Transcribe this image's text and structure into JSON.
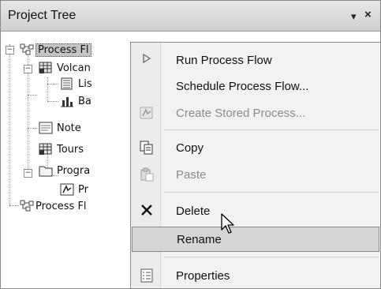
{
  "panel": {
    "title": "Project Tree",
    "pin_glyph": "▾",
    "close_glyph": "×"
  },
  "tree": {
    "nodes": [
      {
        "label": "Process Fl",
        "icon": "process-flow-icon",
        "expander": "−",
        "selected": true
      },
      {
        "label": "Volcan",
        "icon": "data-table-icon",
        "expander": "−"
      },
      {
        "label": "Lis",
        "icon": "list-report-icon"
      },
      {
        "label": "Ba",
        "icon": "bar-chart-icon"
      },
      {
        "label": "Note",
        "icon": "note-icon"
      },
      {
        "label": "Tours",
        "icon": "data-table-icon"
      },
      {
        "label": "Progra",
        "icon": "folder-icon",
        "expander": "−"
      },
      {
        "label": "Pr",
        "icon": "program-icon"
      },
      {
        "label": "Process Fl",
        "icon": "process-flow-icon"
      }
    ]
  },
  "context_menu": {
    "items": [
      {
        "label": "Run Process Flow",
        "icon": "run-triangle-icon",
        "enabled": true
      },
      {
        "label": "Schedule Process Flow...",
        "icon": "",
        "enabled": true
      },
      {
        "label": "Create Stored Process...",
        "icon": "stored-process-icon",
        "enabled": false
      },
      {
        "label": "Copy",
        "icon": "copy-icon",
        "enabled": true
      },
      {
        "label": "Paste",
        "icon": "paste-icon",
        "enabled": false
      },
      {
        "label": "Delete",
        "icon": "delete-x-icon",
        "enabled": true
      },
      {
        "label": "Rename",
        "icon": "",
        "enabled": true,
        "highlighted": true
      },
      {
        "label": "Properties",
        "icon": "properties-icon",
        "enabled": true
      }
    ]
  }
}
